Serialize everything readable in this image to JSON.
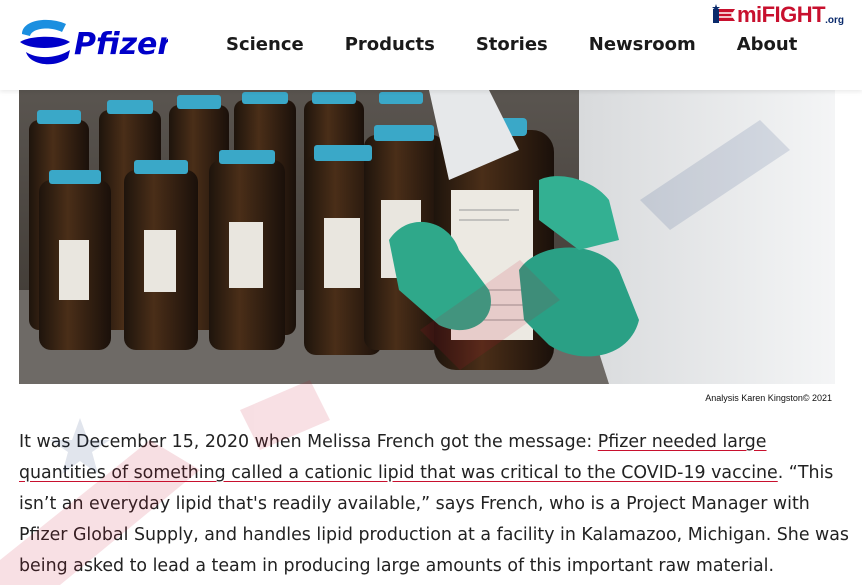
{
  "header": {
    "brand": "Pfizer",
    "nav": [
      "Science",
      "Products",
      "Stories",
      "Newsroom",
      "About"
    ]
  },
  "watermark_logo": {
    "name": "miFIGHT",
    "suffix": ".org"
  },
  "photo": {
    "description_icon": "lab-bottles-photo",
    "credit": "Analysis Karen Kingston© 2021"
  },
  "article": {
    "intro": "It was December 15, 2020 when Melissa French got the message: ",
    "link": "Pfizer needed large quantities of something called a cationic lipid that was critical to the COVID-19 vaccine",
    "rest": ". “This isn’t an everyday lipid that's readily available,” says French, who is a Project Manager with Pfizer Global Supply, and handles lipid production at a facility in Kalamazoo, Michigan. She was being asked to lead a team in producing large amounts of this important raw material."
  },
  "colors": {
    "brand_blue": "#0093d0",
    "brand_dark": "#0000c9",
    "accent_red": "#c8102e"
  }
}
